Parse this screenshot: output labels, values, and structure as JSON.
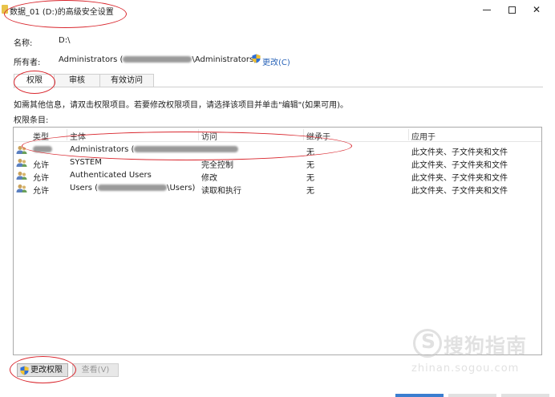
{
  "window": {
    "title": "数据_01 (D:)的高级安全设置"
  },
  "info": {
    "name_label": "名称:",
    "name_value": "D:\\",
    "owner_label": "所有者:",
    "owner_value_prefix": "Administrators (",
    "owner_value_suffix": "\\Administrators)",
    "change_owner_link": "更改(C)"
  },
  "tabs": [
    {
      "label": "权限",
      "active": true
    },
    {
      "label": "审核",
      "active": false
    },
    {
      "label": "有效访问",
      "active": false
    }
  ],
  "instructions": "如需其他信息，请双击权限项目。若要修改权限项目，请选择该项目并单击\"编辑\"(如果可用)。",
  "entries_label": "权限条目:",
  "table": {
    "columns": [
      "类型",
      "主体",
      "访问",
      "继承于",
      "应用于"
    ],
    "rows": [
      {
        "type": "",
        "principal": "Administrators (",
        "access": "",
        "inherited": "无",
        "applies": "此文件夹、子文件夹和文件"
      },
      {
        "type": "允许",
        "principal": "SYSTEM",
        "access": "完全控制",
        "inherited": "无",
        "applies": "此文件夹、子文件夹和文件"
      },
      {
        "type": "允许",
        "principal": "Authenticated Users",
        "access": "修改",
        "inherited": "无",
        "applies": "此文件夹、子文件夹和文件"
      },
      {
        "type": "允许",
        "principal": "Users (",
        "principal_suffix": "\\Users)",
        "access": "读取和执行",
        "inherited": "无",
        "applies": "此文件夹、子文件夹和文件"
      }
    ]
  },
  "buttons": {
    "change_permissions": "更改权限",
    "view": "查看(V)"
  },
  "watermark": {
    "main": "搜狗指南",
    "sub": "zhinan.sogou.com"
  },
  "colors": {
    "link": "#2a64b8",
    "annotation": "#d9272e",
    "shield_blue": "#2f6fd6",
    "shield_yellow": "#f2c230"
  }
}
